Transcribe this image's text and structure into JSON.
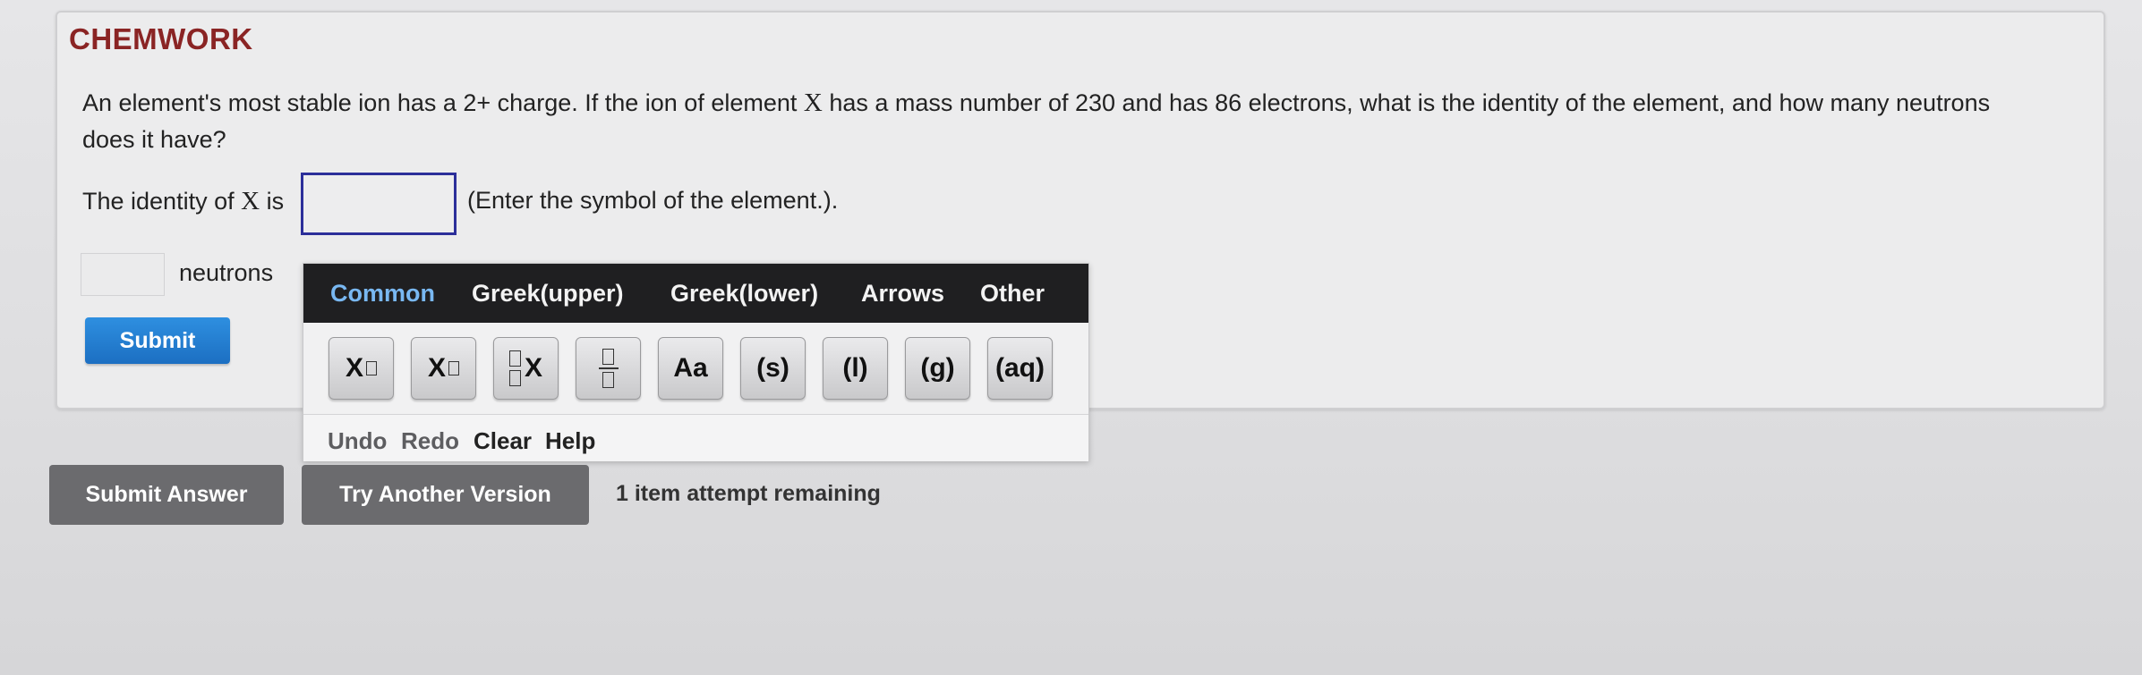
{
  "header": {
    "title": "CHEMWORK"
  },
  "question": {
    "text_part1": "An element's most stable ion has a 2+ charge. If the ion of element ",
    "symbol": "X",
    "text_part2": " has a mass number of 230 and has 86 electrons, what is the identity of the element, and how many neutrons does it have?"
  },
  "identity": {
    "label_prefix": "The identity of ",
    "symbol": "X",
    "label_suffix": " is",
    "input_value": "",
    "hint": "(Enter the symbol of the element.)."
  },
  "neutrons": {
    "input_value": "",
    "label": "neutrons"
  },
  "submit_label": "Submit",
  "palette": {
    "tabs": [
      "Common",
      "Greek(upper)",
      "Greek(lower)",
      "Arrows",
      "Other"
    ],
    "active_tab": "Common",
    "tools": {
      "superscript_x": "X",
      "subscript_x": "X",
      "prescript_x": "X",
      "text_case": "Aa",
      "solid": "(s)",
      "liquid": "(l)",
      "gas": "(g)",
      "aqueous": "(aq)"
    },
    "edit": {
      "undo": "Undo",
      "redo": "Redo",
      "clear": "Clear",
      "help": "Help"
    }
  },
  "footer": {
    "submit_answer": "Submit Answer",
    "try_another": "Try Another Version",
    "attempts": "1 item attempt remaining"
  },
  "colors": {
    "title": "#8a2424",
    "active_tab": "#79b8f2",
    "submit": "#1c6fc2",
    "input_border": "#2c2f9a"
  }
}
